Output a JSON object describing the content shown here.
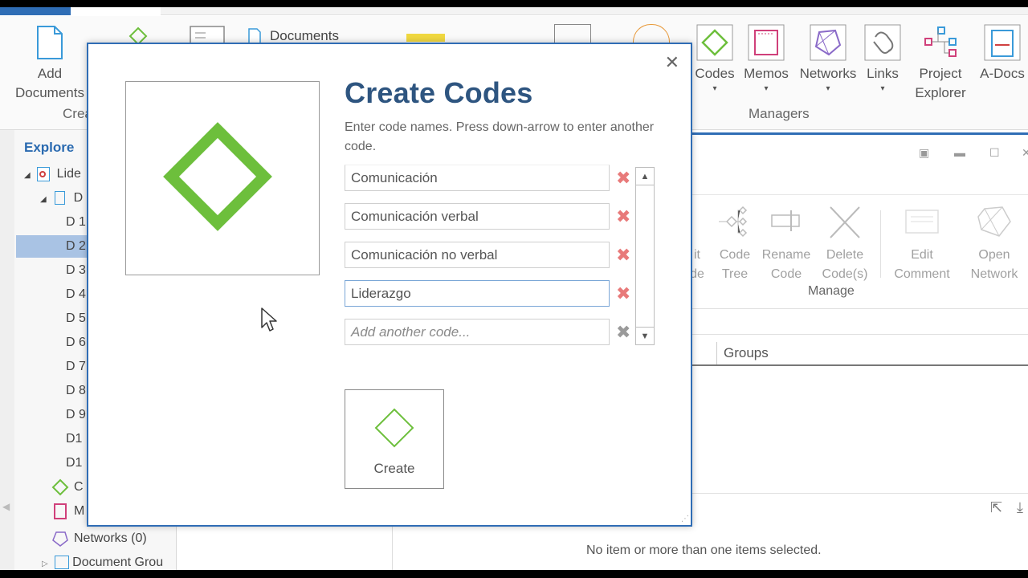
{
  "ribbon": {
    "add_documents": "Add\nDocuments",
    "create_group_label": "Crea",
    "documents": "Documents",
    "codes": "Codes",
    "memos": "Memos",
    "networks": "Networks",
    "links": "Links",
    "project_explorer": "Project\nExplorer",
    "a_docs": "A-Docs",
    "managers_label": "Managers",
    "caret": "▾"
  },
  "explore": {
    "title": "Explore",
    "items": [
      {
        "label": "Lide"
      },
      {
        "label": "D"
      },
      {
        "label": "D 1"
      },
      {
        "label": "D 2"
      },
      {
        "label": "D 3"
      },
      {
        "label": "D 4"
      },
      {
        "label": "D 5"
      },
      {
        "label": "D 6"
      },
      {
        "label": "D 7"
      },
      {
        "label": "D 8"
      },
      {
        "label": "D 9"
      },
      {
        "label": "D1"
      },
      {
        "label": "D1"
      },
      {
        "label": "C"
      },
      {
        "label": "M"
      },
      {
        "label": "Networks (0)"
      },
      {
        "label": "Document Grou"
      }
    ]
  },
  "right_panel": {
    "manage_buttons": [
      {
        "label": "it\nde"
      },
      {
        "label": "Code\nTree"
      },
      {
        "label": "Rename\nCode"
      },
      {
        "label": "Delete\nCode(s)"
      },
      {
        "label": "Edit\nComment"
      },
      {
        "label": "Open\nNetwork"
      }
    ],
    "manage_label": "Manage",
    "groups_header": "Groups",
    "status": "No item or more than one items selected."
  },
  "dialog": {
    "title": "Create Codes",
    "hint": "Enter code names. Press down-arrow to enter another code.",
    "codes": [
      "Comunicación",
      "Comunicación verbal",
      "Comunicación no verbal",
      "Liderazgo"
    ],
    "add_placeholder": "Add another code...",
    "create_label": "Create",
    "close_glyph": "✕",
    "delete_glyph": "✖",
    "accent_color": "#6dbf3c"
  }
}
